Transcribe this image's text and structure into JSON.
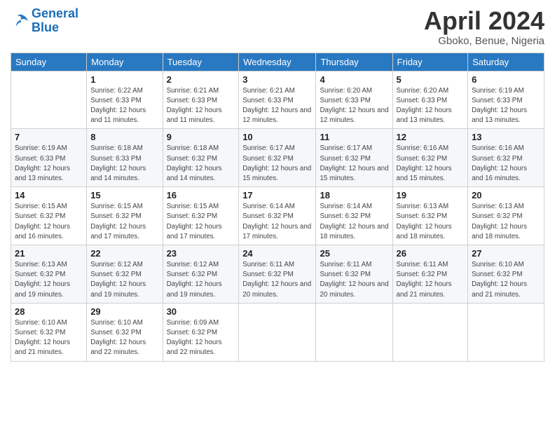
{
  "logo": {
    "line1": "General",
    "line2": "Blue"
  },
  "title": "April 2024",
  "subtitle": "Gboko, Benue, Nigeria",
  "weekdays": [
    "Sunday",
    "Monday",
    "Tuesday",
    "Wednesday",
    "Thursday",
    "Friday",
    "Saturday"
  ],
  "weeks": [
    [
      {
        "day": "",
        "sunrise": "",
        "sunset": "",
        "daylight": ""
      },
      {
        "day": "1",
        "sunrise": "Sunrise: 6:22 AM",
        "sunset": "Sunset: 6:33 PM",
        "daylight": "Daylight: 12 hours and 11 minutes."
      },
      {
        "day": "2",
        "sunrise": "Sunrise: 6:21 AM",
        "sunset": "Sunset: 6:33 PM",
        "daylight": "Daylight: 12 hours and 11 minutes."
      },
      {
        "day": "3",
        "sunrise": "Sunrise: 6:21 AM",
        "sunset": "Sunset: 6:33 PM",
        "daylight": "Daylight: 12 hours and 12 minutes."
      },
      {
        "day": "4",
        "sunrise": "Sunrise: 6:20 AM",
        "sunset": "Sunset: 6:33 PM",
        "daylight": "Daylight: 12 hours and 12 minutes."
      },
      {
        "day": "5",
        "sunrise": "Sunrise: 6:20 AM",
        "sunset": "Sunset: 6:33 PM",
        "daylight": "Daylight: 12 hours and 13 minutes."
      },
      {
        "day": "6",
        "sunrise": "Sunrise: 6:19 AM",
        "sunset": "Sunset: 6:33 PM",
        "daylight": "Daylight: 12 hours and 13 minutes."
      }
    ],
    [
      {
        "day": "7",
        "sunrise": "Sunrise: 6:19 AM",
        "sunset": "Sunset: 6:33 PM",
        "daylight": "Daylight: 12 hours and 13 minutes."
      },
      {
        "day": "8",
        "sunrise": "Sunrise: 6:18 AM",
        "sunset": "Sunset: 6:33 PM",
        "daylight": "Daylight: 12 hours and 14 minutes."
      },
      {
        "day": "9",
        "sunrise": "Sunrise: 6:18 AM",
        "sunset": "Sunset: 6:32 PM",
        "daylight": "Daylight: 12 hours and 14 minutes."
      },
      {
        "day": "10",
        "sunrise": "Sunrise: 6:17 AM",
        "sunset": "Sunset: 6:32 PM",
        "daylight": "Daylight: 12 hours and 15 minutes."
      },
      {
        "day": "11",
        "sunrise": "Sunrise: 6:17 AM",
        "sunset": "Sunset: 6:32 PM",
        "daylight": "Daylight: 12 hours and 15 minutes."
      },
      {
        "day": "12",
        "sunrise": "Sunrise: 6:16 AM",
        "sunset": "Sunset: 6:32 PM",
        "daylight": "Daylight: 12 hours and 15 minutes."
      },
      {
        "day": "13",
        "sunrise": "Sunrise: 6:16 AM",
        "sunset": "Sunset: 6:32 PM",
        "daylight": "Daylight: 12 hours and 16 minutes."
      }
    ],
    [
      {
        "day": "14",
        "sunrise": "Sunrise: 6:15 AM",
        "sunset": "Sunset: 6:32 PM",
        "daylight": "Daylight: 12 hours and 16 minutes."
      },
      {
        "day": "15",
        "sunrise": "Sunrise: 6:15 AM",
        "sunset": "Sunset: 6:32 PM",
        "daylight": "Daylight: 12 hours and 17 minutes."
      },
      {
        "day": "16",
        "sunrise": "Sunrise: 6:15 AM",
        "sunset": "Sunset: 6:32 PM",
        "daylight": "Daylight: 12 hours and 17 minutes."
      },
      {
        "day": "17",
        "sunrise": "Sunrise: 6:14 AM",
        "sunset": "Sunset: 6:32 PM",
        "daylight": "Daylight: 12 hours and 17 minutes."
      },
      {
        "day": "18",
        "sunrise": "Sunrise: 6:14 AM",
        "sunset": "Sunset: 6:32 PM",
        "daylight": "Daylight: 12 hours and 18 minutes."
      },
      {
        "day": "19",
        "sunrise": "Sunrise: 6:13 AM",
        "sunset": "Sunset: 6:32 PM",
        "daylight": "Daylight: 12 hours and 18 minutes."
      },
      {
        "day": "20",
        "sunrise": "Sunrise: 6:13 AM",
        "sunset": "Sunset: 6:32 PM",
        "daylight": "Daylight: 12 hours and 18 minutes."
      }
    ],
    [
      {
        "day": "21",
        "sunrise": "Sunrise: 6:13 AM",
        "sunset": "Sunset: 6:32 PM",
        "daylight": "Daylight: 12 hours and 19 minutes."
      },
      {
        "day": "22",
        "sunrise": "Sunrise: 6:12 AM",
        "sunset": "Sunset: 6:32 PM",
        "daylight": "Daylight: 12 hours and 19 minutes."
      },
      {
        "day": "23",
        "sunrise": "Sunrise: 6:12 AM",
        "sunset": "Sunset: 6:32 PM",
        "daylight": "Daylight: 12 hours and 19 minutes."
      },
      {
        "day": "24",
        "sunrise": "Sunrise: 6:11 AM",
        "sunset": "Sunset: 6:32 PM",
        "daylight": "Daylight: 12 hours and 20 minutes."
      },
      {
        "day": "25",
        "sunrise": "Sunrise: 6:11 AM",
        "sunset": "Sunset: 6:32 PM",
        "daylight": "Daylight: 12 hours and 20 minutes."
      },
      {
        "day": "26",
        "sunrise": "Sunrise: 6:11 AM",
        "sunset": "Sunset: 6:32 PM",
        "daylight": "Daylight: 12 hours and 21 minutes."
      },
      {
        "day": "27",
        "sunrise": "Sunrise: 6:10 AM",
        "sunset": "Sunset: 6:32 PM",
        "daylight": "Daylight: 12 hours and 21 minutes."
      }
    ],
    [
      {
        "day": "28",
        "sunrise": "Sunrise: 6:10 AM",
        "sunset": "Sunset: 6:32 PM",
        "daylight": "Daylight: 12 hours and 21 minutes."
      },
      {
        "day": "29",
        "sunrise": "Sunrise: 6:10 AM",
        "sunset": "Sunset: 6:32 PM",
        "daylight": "Daylight: 12 hours and 22 minutes."
      },
      {
        "day": "30",
        "sunrise": "Sunrise: 6:09 AM",
        "sunset": "Sunset: 6:32 PM",
        "daylight": "Daylight: 12 hours and 22 minutes."
      },
      {
        "day": "",
        "sunrise": "",
        "sunset": "",
        "daylight": ""
      },
      {
        "day": "",
        "sunrise": "",
        "sunset": "",
        "daylight": ""
      },
      {
        "day": "",
        "sunrise": "",
        "sunset": "",
        "daylight": ""
      },
      {
        "day": "",
        "sunrise": "",
        "sunset": "",
        "daylight": ""
      }
    ]
  ]
}
